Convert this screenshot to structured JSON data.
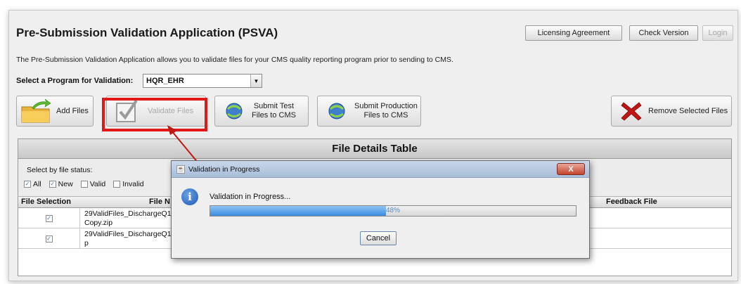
{
  "app": {
    "title": "Pre-Submission Validation Application (PSVA)",
    "description": "The Pre-Submission Validation Application allows you to validate files for your CMS quality reporting program prior to sending to CMS."
  },
  "header_buttons": {
    "licensing": "Licensing Agreement",
    "check_version": "Check Version",
    "login": "Login"
  },
  "program": {
    "label": "Select a Program for Validation:",
    "selected": "HQR_EHR"
  },
  "toolbar": {
    "add_files": "Add Files",
    "validate_files": "Validate Files",
    "submit_test_line1": "Submit Test",
    "submit_test_line2": "Files to CMS",
    "submit_prod_line1": "Submit Production",
    "submit_prod_line2": "Files to CMS",
    "remove_selected": "Remove Selected Files"
  },
  "table": {
    "title": "File Details Table",
    "filter_label": "Select by file status:",
    "filters": [
      {
        "label": "All",
        "checked": true
      },
      {
        "label": "New",
        "checked": true
      },
      {
        "label": "Valid",
        "checked": false
      },
      {
        "label": "Invalid",
        "checked": false
      }
    ],
    "columns": {
      "selection": "File Selection",
      "name": "File N",
      "feedback": "Feedback File"
    },
    "rows": [
      {
        "name_line1": "29ValidFiles_DischargeQ1-",
        "name_line2": "Copy.zip",
        "checked": true
      },
      {
        "name_line1": "29ValidFiles_DischargeQ1-",
        "name_line2": "p",
        "checked": true
      }
    ]
  },
  "dialog": {
    "title": "Validation in Progress",
    "close": "X",
    "message": "Validation in Progress...",
    "progress_percent": 48,
    "progress_text": "48%",
    "cancel": "Cancel"
  },
  "colors": {
    "highlight": "#e01818",
    "progress_fill": "#3b8ae0",
    "remove_icon": "#c01515"
  }
}
